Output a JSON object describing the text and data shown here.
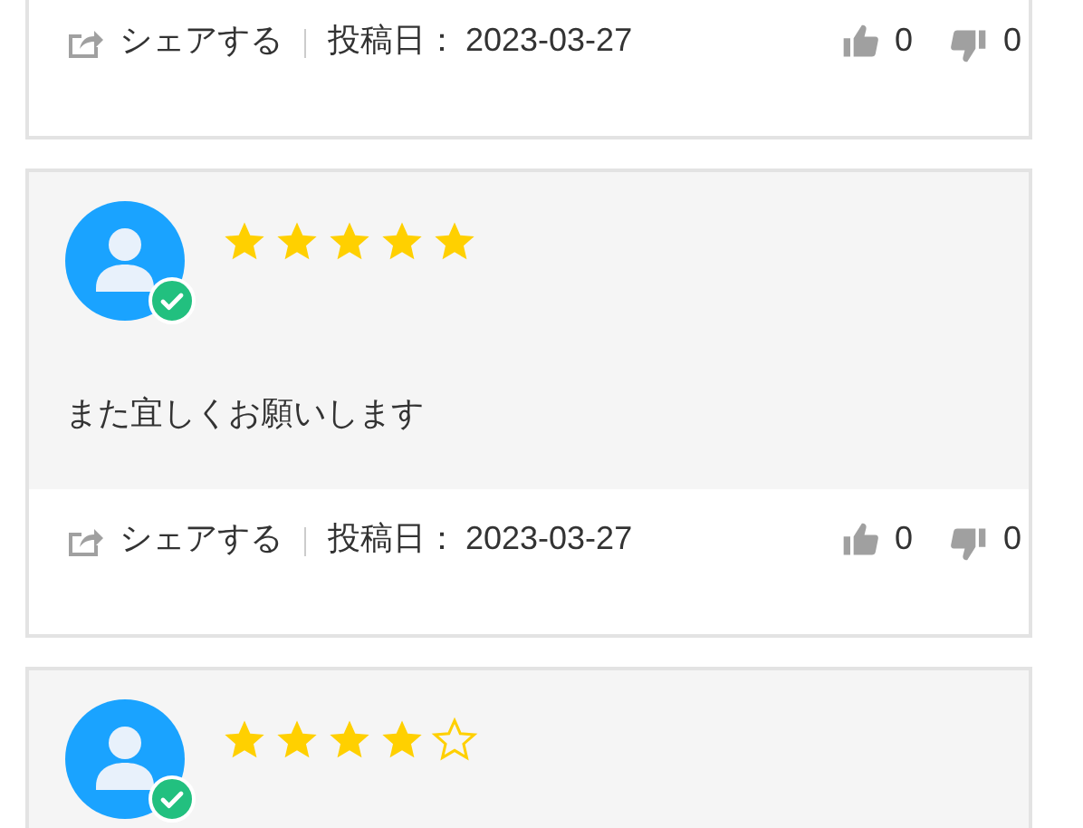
{
  "reviews": [
    {
      "footer": {
        "share": "シェアする",
        "date_label": "投稿日：",
        "date": "2023-03-27",
        "likes": "0",
        "dislikes": "0"
      }
    },
    {
      "verified": true,
      "stars": 5,
      "comment": "また宜しくお願いします",
      "footer": {
        "share": "シェアする",
        "date_label": "投稿日：",
        "date": "2023-03-27",
        "likes": "0",
        "dislikes": "0"
      }
    },
    {
      "verified": true,
      "stars": 4
    }
  ]
}
